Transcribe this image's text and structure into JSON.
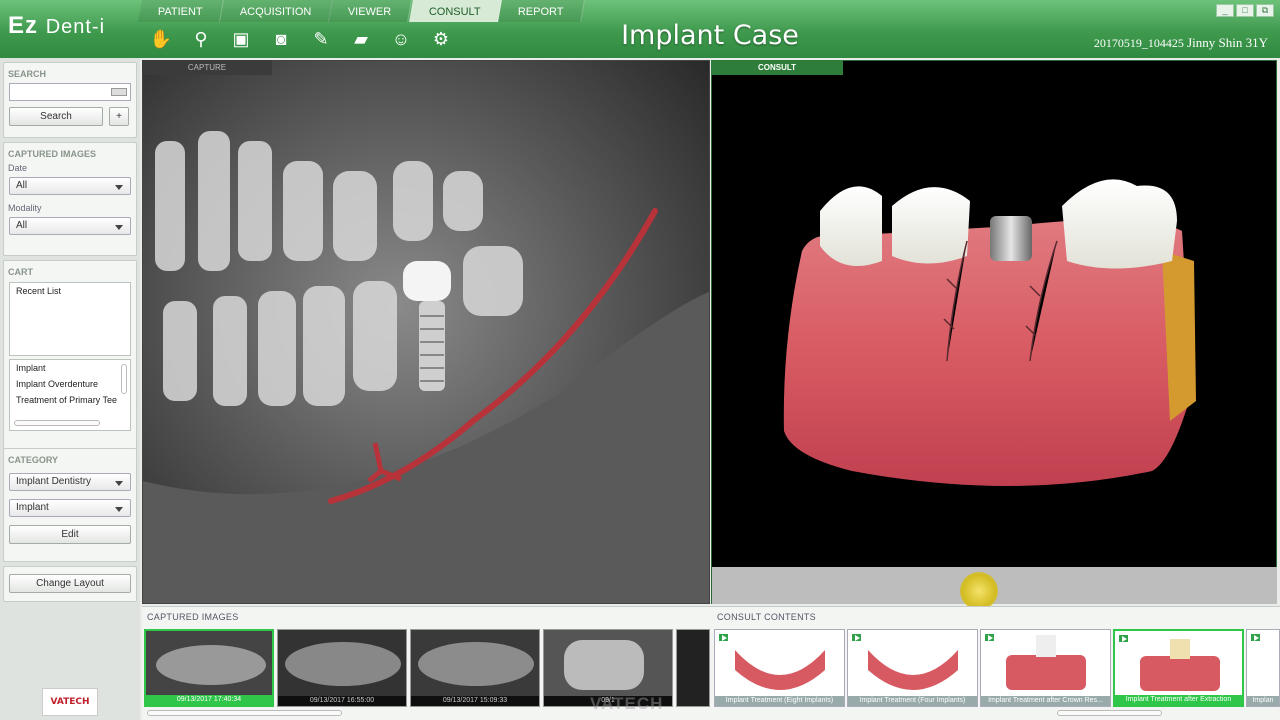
{
  "app": {
    "logo": "Ez",
    "logo_sub": "Dent-i",
    "title": "Implant Case"
  },
  "patient": {
    "id": "20170519_104425",
    "name": "Jinny Shin 31Y"
  },
  "window_buttons": [
    "_",
    "□",
    "⧉"
  ],
  "tabs": [
    {
      "label": "PATIENT"
    },
    {
      "label": "ACQUISITION"
    },
    {
      "label": "VIEWER"
    },
    {
      "label": "CONSULT"
    },
    {
      "label": "REPORT"
    }
  ],
  "tools": [
    "hand-icon",
    "magnify-icon",
    "capture-icon",
    "camera-icon",
    "pen-icon",
    "eraser-icon",
    "face-icon",
    "settings-camera-icon"
  ],
  "sidebar": {
    "search": {
      "heading": "SEARCH",
      "placeholder": "",
      "button": "Search",
      "add": "+"
    },
    "captured": {
      "heading": "CAPTURED IMAGES",
      "date_label": "Date",
      "date_value": "All",
      "modality_label": "Modality",
      "modality_value": "All"
    },
    "cart": {
      "heading": "CART",
      "recent": "Recent List",
      "items": [
        "Implant",
        "Implant Overdenture",
        "Treatment of Primary Tee"
      ]
    },
    "category": {
      "heading": "CATEGORY",
      "value1": "Implant Dentistry",
      "value2": "Implant",
      "edit": "Edit"
    },
    "change_layout": "Change Layout"
  },
  "panels": {
    "capture_label": "CAPTURE",
    "consult_label": "CONSULT"
  },
  "strip": {
    "captured_label": "CAPTURED IMAGES",
    "consult_label": "CONSULT CONTENTS",
    "captured_thumbs": [
      "09/13/2017 17:40:34",
      "09/13/2017 16:55:00",
      "09/13/2017 15:09:33",
      "09/1"
    ],
    "consult_thumbs": [
      "Implant Treatment (Eight Implants)",
      "Implant Treatment (Four Implants)",
      "Implant Treatment after Crown Res...",
      "Implant Treatment after Extraction",
      "Implan"
    ]
  },
  "brand": {
    "vatech": "VATECH",
    "watermark": "VATECH"
  },
  "colors": {
    "accent": "#3f9a4e",
    "selected": "#2fc64a"
  }
}
